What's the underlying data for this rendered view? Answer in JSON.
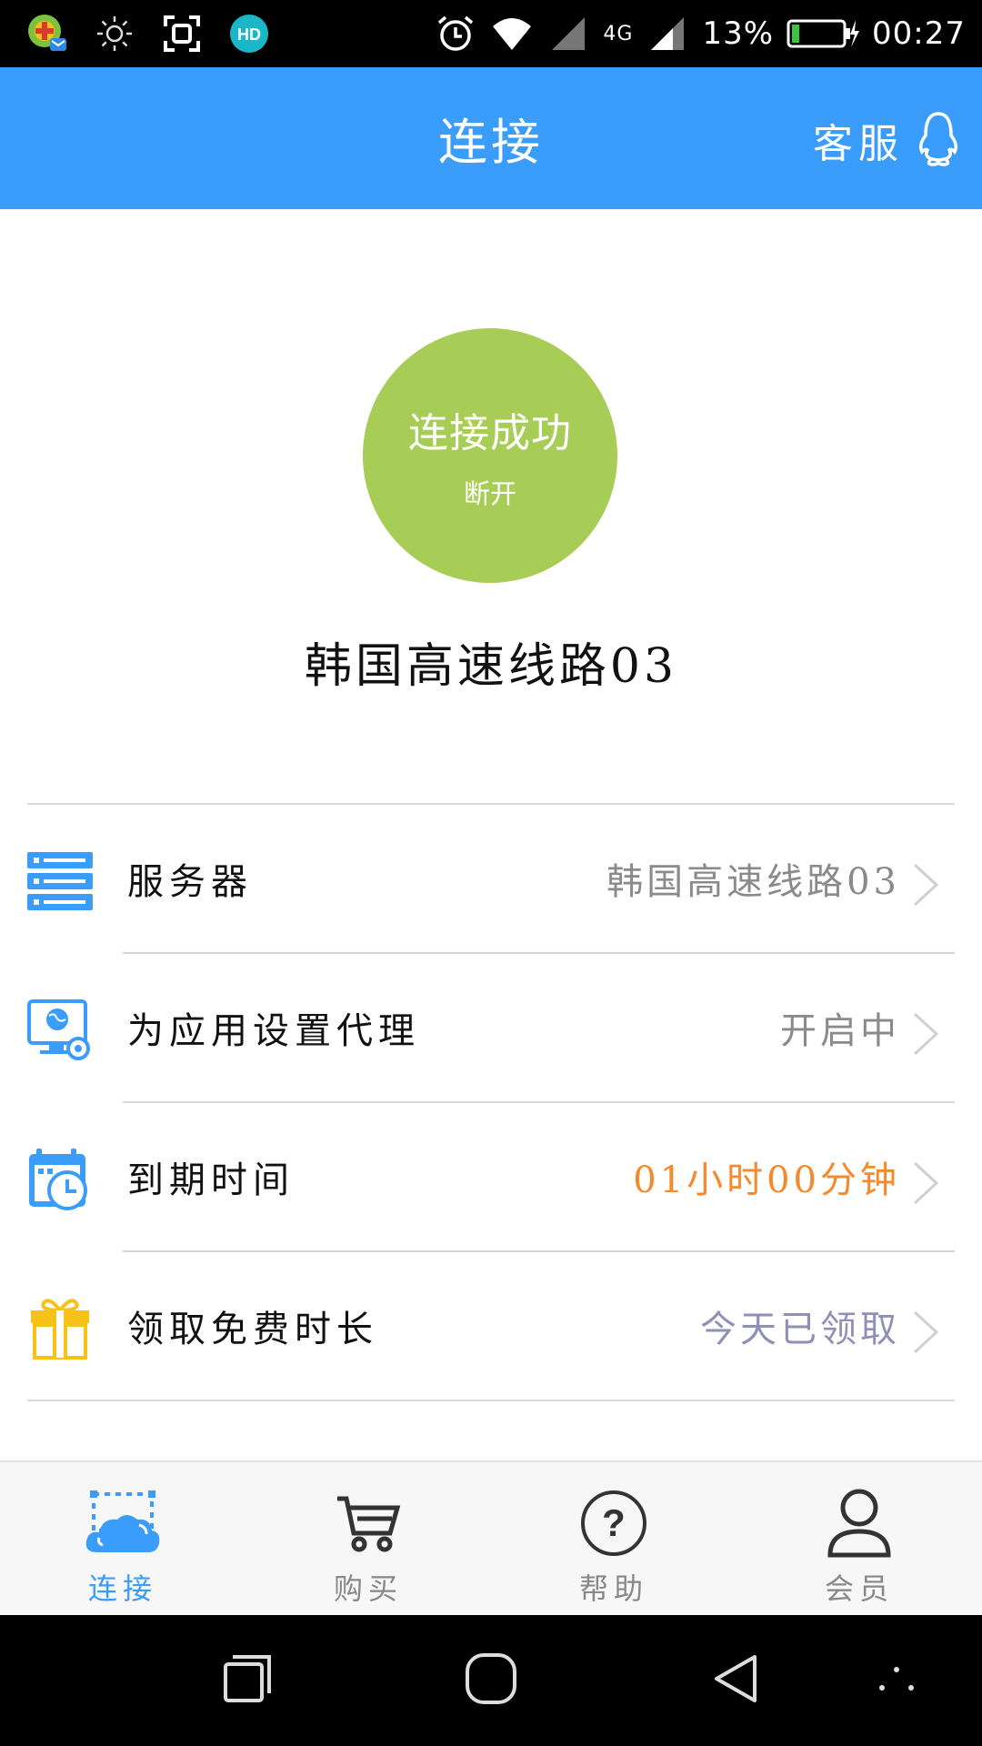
{
  "status_bar": {
    "battery": "13%",
    "time": "00:27",
    "network": "4G"
  },
  "header": {
    "title": "连接",
    "support_label": "客服"
  },
  "connect": {
    "status": "连接成功",
    "action": "断开",
    "server_name": "韩国高速线路03",
    "circle_color": "#a7cd56"
  },
  "list": [
    {
      "label": "服务器",
      "value": "韩国高速线路03",
      "icon": "server-icon",
      "value_color": "#8a8a8a"
    },
    {
      "label": "为应用设置代理",
      "value": "开启中",
      "icon": "monitor-globe-gear-icon",
      "value_color": "#8a8a8a"
    },
    {
      "label": "到期时间",
      "value": "01小时00分钟",
      "icon": "calendar-clock-icon",
      "value_color": "#f58a2d"
    },
    {
      "label": "领取免费时长",
      "value": "今天已领取",
      "icon": "gift-icon",
      "value_color": "#8f8fb8"
    }
  ],
  "tabs": [
    {
      "label": "连接",
      "icon": "cloud-icon",
      "active": true
    },
    {
      "label": "购买",
      "icon": "cart-icon",
      "active": false
    },
    {
      "label": "帮助",
      "icon": "help-icon",
      "active": false
    },
    {
      "label": "会员",
      "icon": "user-icon",
      "active": false
    }
  ],
  "colors": {
    "brand": "#3a9cfb",
    "expiry_value": "#f58a2d",
    "free_value": "#8f8fb8"
  }
}
